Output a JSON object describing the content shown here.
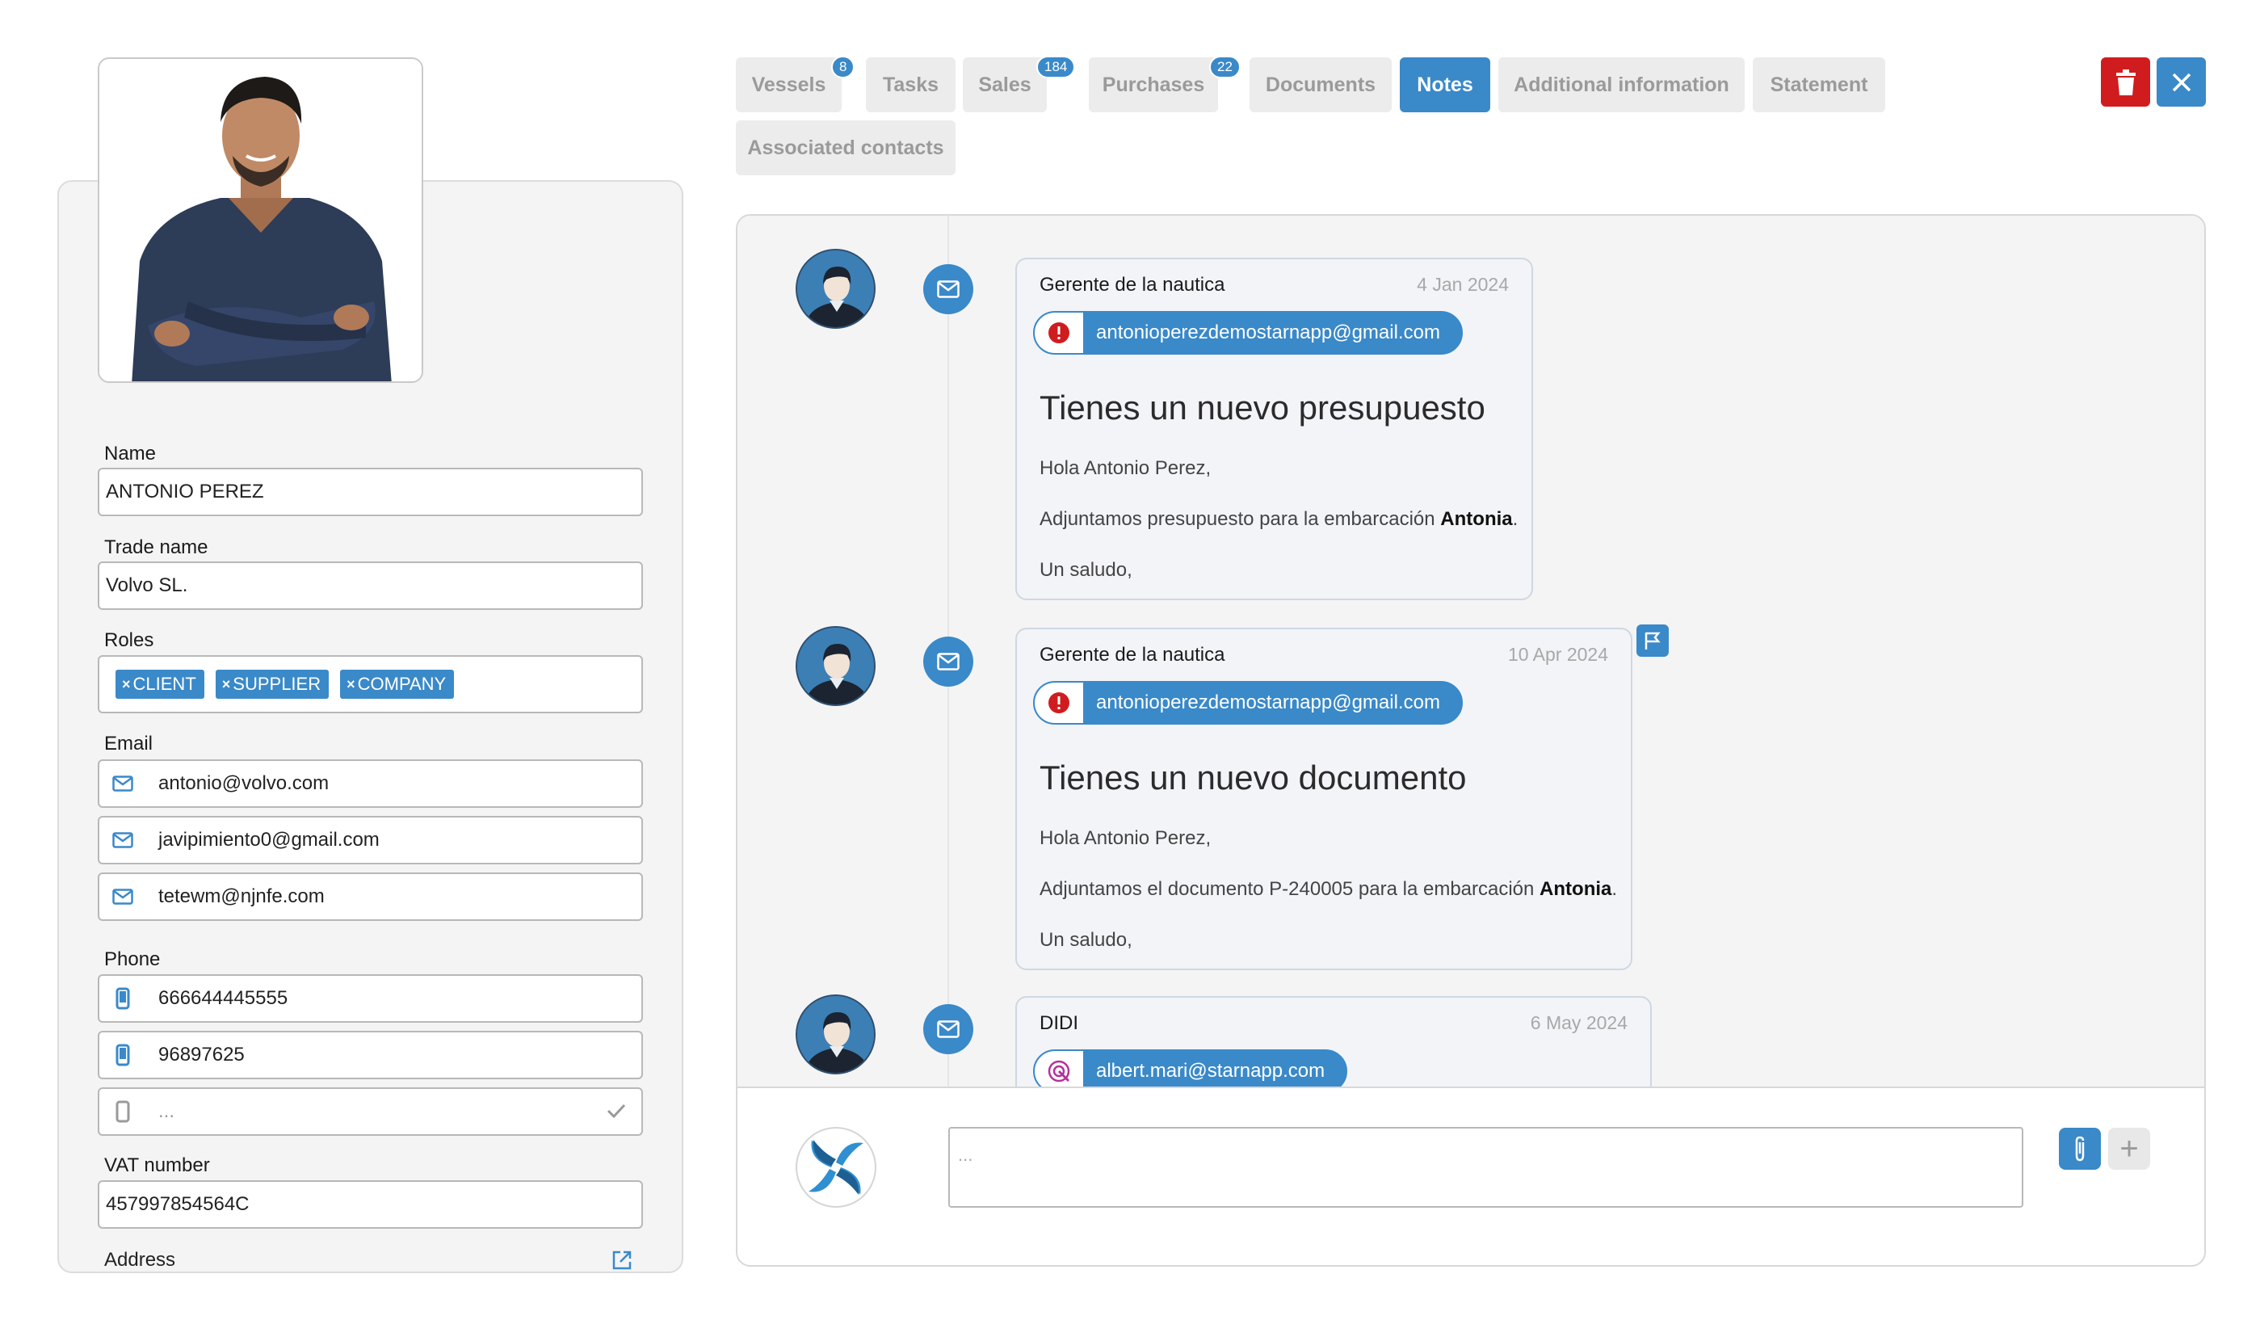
{
  "colors": {
    "accent": "#3a89c9",
    "danger": "#d01c1f",
    "tab_bg": "#ececec",
    "panel_bg": "#f4f4f5"
  },
  "contact": {
    "name_label": "Name",
    "name_value": "ANTONIO PEREZ",
    "trade_label": "Trade name",
    "trade_value": "Volvo SL.",
    "roles_label": "Roles",
    "roles": [
      "CLIENT",
      "SUPPLIER",
      "COMPANY"
    ],
    "email_label": "Email",
    "emails": [
      "antonio@volvo.com",
      "javipimiento0@gmail.com",
      "tetewm@njnfe.com"
    ],
    "phone_label": "Phone",
    "phones": [
      "666644445555",
      "96897625"
    ],
    "phone_placeholder": "...",
    "vat_label": "VAT number",
    "vat_value": "457997854564C",
    "address_label": "Address"
  },
  "tabs": [
    {
      "label": "Vessels",
      "badge": "8"
    },
    {
      "label": "Tasks"
    },
    {
      "label": "Sales",
      "badge": "184"
    },
    {
      "label": "Purchases",
      "badge": "22"
    },
    {
      "label": "Documents"
    },
    {
      "label": "Notes",
      "active": true
    },
    {
      "label": "Additional information"
    },
    {
      "label": "Statement"
    },
    {
      "label": "Associated contacts"
    }
  ],
  "icons": {
    "delete": "trash-icon",
    "close": "close-icon",
    "mail": "envelope-icon",
    "phone": "mobile-phone-icon",
    "flag": "flag-icon",
    "attach": "paperclip-icon",
    "add": "plus-icon",
    "external": "external-link-icon"
  },
  "notes": [
    {
      "author": "Gerente de la nautica",
      "date": "4 Jan 2024",
      "email": "antonioperezdemostarnapp@gmail.com",
      "subject": "Tienes un nuevo presupuesto",
      "greeting": "Hola Antonio Perez,",
      "body_prefix": "Adjuntamos presupuesto  para la embarcación ",
      "body_bold": "Antonia",
      "body_suffix": ".",
      "closing": "Un saludo,"
    },
    {
      "author": "Gerente de la nautica",
      "date": "10 Apr 2024",
      "email": "antonioperezdemostarnapp@gmail.com",
      "subject": "Tienes un nuevo documento",
      "greeting": "Hola Antonio Perez,",
      "body_prefix": "Adjuntamos el documento P-240005  para la embarcación ",
      "body_bold": "Antonia",
      "body_suffix": ".",
      "closing": "Un saludo,"
    },
    {
      "author": "DIDI",
      "date": "6 May 2024",
      "email": "albert.mari@starnapp.com"
    }
  ],
  "composer": {
    "placeholder": "...",
    "plus": "+"
  }
}
